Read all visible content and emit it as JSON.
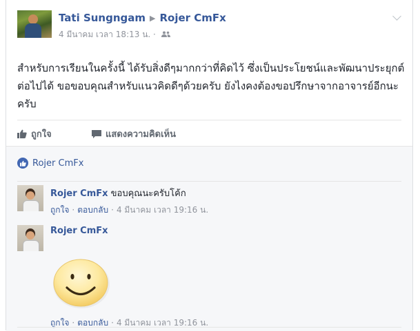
{
  "post": {
    "author": "Tati Sungngam",
    "recipient": "Rojer CmFx",
    "timestamp": "4 มีนาคม เวลา 18:13 น.",
    "separator": "·",
    "body": "สำหรับการเรียนในครั้งนี้ ได้รับสิ่งดีๆมากกว่าที่คิดไว้ ซึ่งเป็นประโยชน์และพัฒนาประยุกต์ต่อไปได้ ขอขอบคุณสำหรับแนวคิดดีๆด้วยครับ ยังไงคงต้องขอปรึกษาจากอาจารย์อีกนะครับ"
  },
  "actions": {
    "like_label": "ถูกใจ",
    "comment_label": "แสดงความคิดเห็น"
  },
  "reactions": {
    "liked_by": "Rojer CmFx"
  },
  "comments": [
    {
      "author": "Rojer CmFx",
      "text": "ขอบคุณนะครับโค้ก",
      "like_label": "ถูกใจ",
      "reply_label": "ตอบกลับ",
      "timestamp": "4 มีนาคม เวลา 19:16 น."
    },
    {
      "author": "Rojer CmFx",
      "text": "",
      "sticker": "smiley-sticker",
      "like_label": "ถูกใจ",
      "reply_label": "ตอบกลับ",
      "timestamp": "4 มีนาคม เวลา 19:16 น."
    }
  ],
  "colors": {
    "link": "#365899",
    "meta": "#90949c",
    "like_badge": "#4267b2",
    "comments_bg": "#f6f7f9"
  }
}
